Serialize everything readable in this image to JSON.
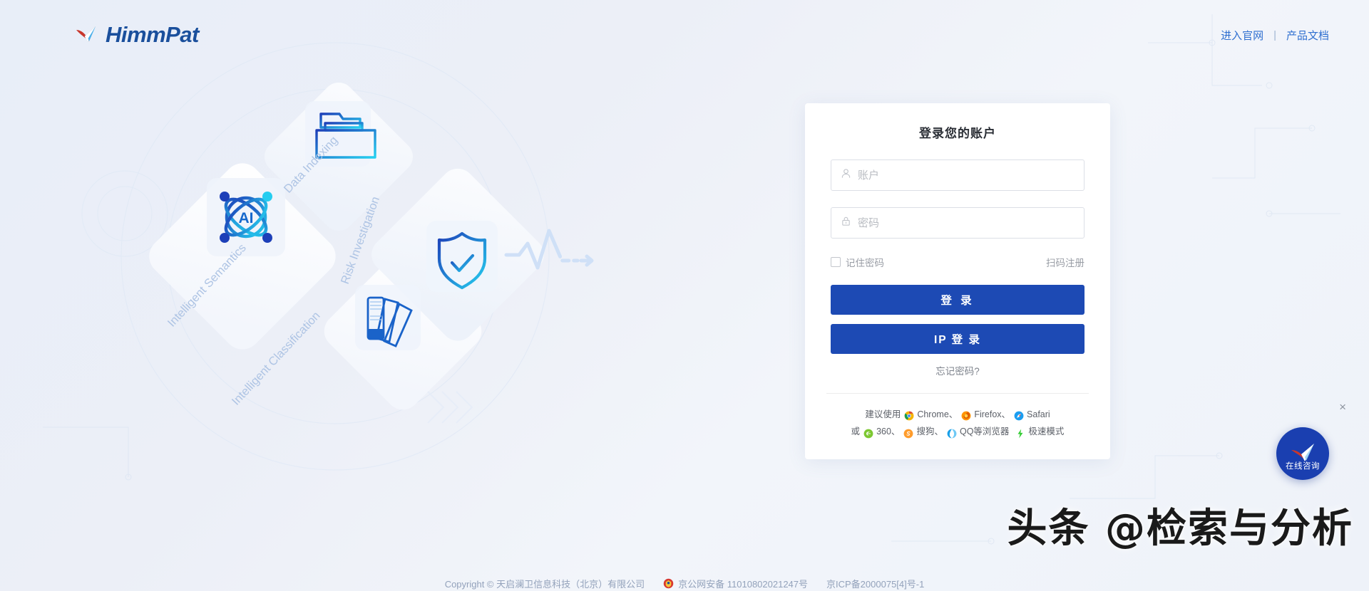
{
  "brand": {
    "name": "HimmPat",
    "logo_icon": "checkmark-swoosh-logo"
  },
  "header": {
    "links": [
      {
        "label": "进入官网",
        "name": "official-site-link"
      },
      {
        "label": "产品文档",
        "name": "product-docs-link"
      }
    ],
    "separator": "|"
  },
  "illustration": {
    "labels": [
      "Intelligent Semantics",
      "Data Indexing",
      "Risk Investigation",
      "Intelligent Classification"
    ],
    "icons": [
      "ai-network-icon",
      "folder-files-icon",
      "shield-check-icon",
      "color-swatch-icon",
      "pulse-arrow-icon"
    ]
  },
  "login": {
    "title": "登录您的账户",
    "account": {
      "placeholder": "账户",
      "value": "",
      "icon": "user-icon"
    },
    "password": {
      "placeholder": "密码",
      "value": "",
      "icon": "lock-icon"
    },
    "remember_label": "记住密码",
    "remember_checked": false,
    "qr_register_label": "扫码注册",
    "login_button": "登 录",
    "ip_login_button": "IP 登 录",
    "forgot_label": "忘记密码?",
    "accent_color": "#1d4ab4"
  },
  "browsers": {
    "lead_line1": "建议使用",
    "lead_line2": "或",
    "line1": [
      {
        "label": "Chrome",
        "icon": "chrome-icon",
        "sep": "、"
      },
      {
        "label": "Firefox",
        "icon": "firefox-icon",
        "sep": "、"
      },
      {
        "label": "Safari",
        "icon": "safari-icon",
        "sep": ""
      }
    ],
    "line2": [
      {
        "label": "360",
        "icon": "ie360-icon",
        "sep": "、"
      },
      {
        "label": "搜狗",
        "icon": "sogou-icon",
        "sep": "、"
      },
      {
        "label": "QQ等浏览器",
        "icon": "qq-icon",
        "sep": ""
      },
      {
        "label": "极速模式",
        "icon": "lightning-icon",
        "sep": ""
      }
    ]
  },
  "chat": {
    "label": "在线咨询",
    "icon": "paper-plane-icon",
    "close_icon": "×",
    "color": "#1a3fb0"
  },
  "watermark": {
    "text": "头条 @检索与分析"
  },
  "footer": {
    "copyright": "Copyright © 天启澜卫信息科技（北京）有限公司",
    "beian_police": "京公网安备 11010802021247号",
    "beian_icp": "京ICP备2000075[4]号-1"
  }
}
